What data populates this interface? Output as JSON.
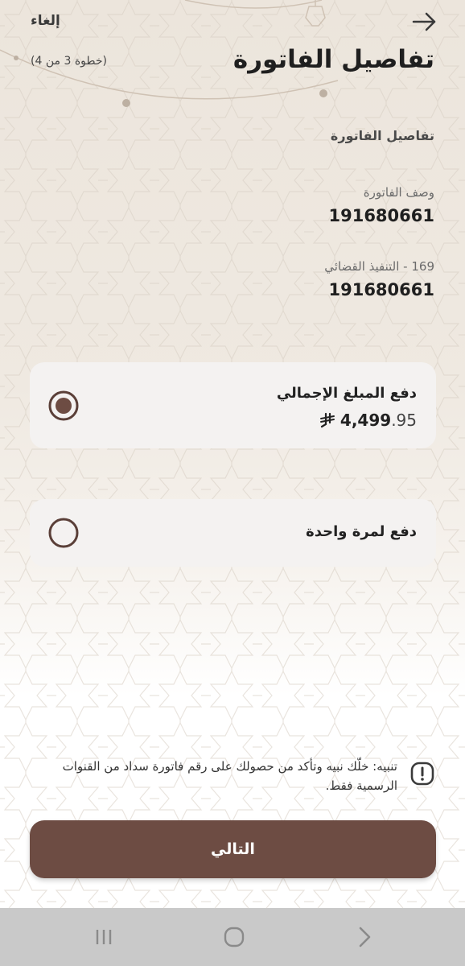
{
  "header": {
    "cancel_label": "إلغاء",
    "title": "تفاصيل الفاتورة",
    "step": "(خطوة 3 من 4)"
  },
  "invoice": {
    "section_title": "تفاصيل الفاتورة",
    "description_label": "وصف الفاتورة",
    "description_value": "191680661",
    "category_label": "169 - التنفيذ القضائي",
    "category_value": "191680661"
  },
  "payment_options": {
    "full": {
      "label": "دفع المبلغ الإجمالي",
      "amount_integer": "4,499",
      "amount_decimal": ".95",
      "currency_icon": "riyal-icon",
      "selected": true
    },
    "once": {
      "label": "دفع لمرة واحدة",
      "selected": false
    }
  },
  "notice": {
    "text": "تنبيه: خلّك نبيه وتأكد من حصولك على رقم فاتورة سداد من القنوات الرسمية فقط.",
    "icon": "exclamation-icon"
  },
  "footer": {
    "next_label": "التالي"
  },
  "colors": {
    "primary": "#6d4c43",
    "card_bg": "#f4f2f1",
    "nav_bar": "#c9c9c9"
  }
}
